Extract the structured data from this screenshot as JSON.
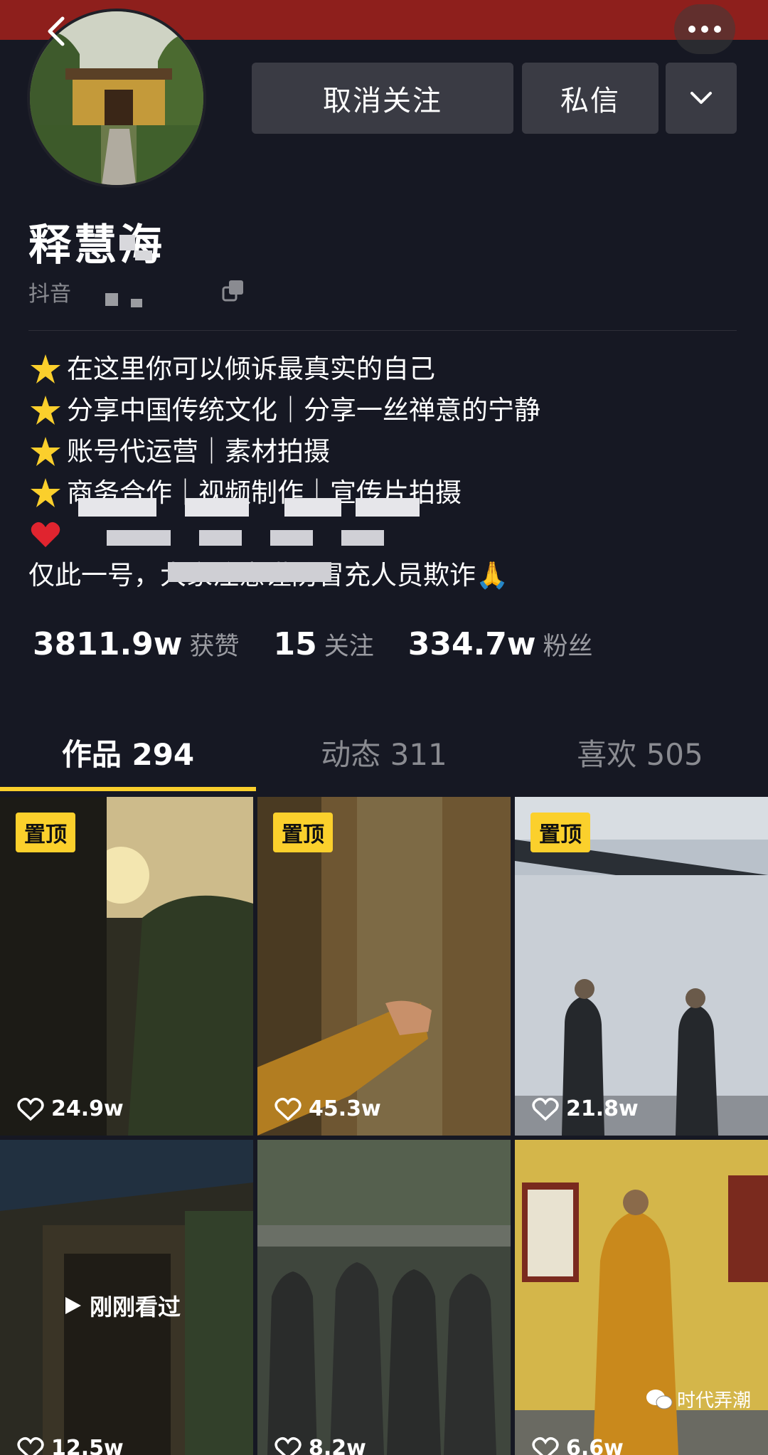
{
  "header": {
    "back_icon": "chevron-left-icon",
    "more_icon": "more-dots-icon"
  },
  "actions": {
    "unfollow_label": "取消关注",
    "message_label": "私信",
    "dropdown_icon": "chevron-down-icon"
  },
  "profile": {
    "name": "释慧海",
    "douyin_id_prefix": "抖音"
  },
  "bio": [
    {
      "emoji": "star",
      "text": "在这里你可以倾诉最真实的自己"
    },
    {
      "emoji": "star",
      "text": "分享中国传统文化｜分享一丝禅意的宁静"
    },
    {
      "emoji": "star",
      "text": "账号代运营｜素材拍摄"
    },
    {
      "emoji": "star",
      "text": "商务合作｜视频制作｜宣传片拍摄"
    },
    {
      "emoji": "heart",
      "text": ""
    },
    {
      "emoji": "",
      "text": "仅此一号，大家注意谨防冒充人员欺诈🙏"
    }
  ],
  "stats": {
    "likes_value": "3811.9w",
    "likes_label": "获赞",
    "following_value": "15",
    "following_label": "关注",
    "followers_value": "334.7w",
    "followers_label": "粉丝"
  },
  "tabs": [
    {
      "label": "作品 294",
      "active": true
    },
    {
      "label": "动态 311",
      "active": false
    },
    {
      "label": "喜欢 505",
      "active": false
    }
  ],
  "videos": [
    {
      "pinned": true,
      "pin_label": "置顶",
      "likes": "24.9w"
    },
    {
      "pinned": true,
      "pin_label": "置顶",
      "likes": "45.3w"
    },
    {
      "pinned": true,
      "pin_label": "置顶",
      "likes": "21.8w"
    },
    {
      "pinned": false,
      "likes": "12.5w",
      "watched_label": "刚刚看过"
    },
    {
      "pinned": false,
      "likes": "8.2w"
    },
    {
      "pinned": false,
      "likes": "6.6w"
    }
  ],
  "watermark": {
    "text": "时代弄潮",
    "icon": "wechat-icon"
  },
  "colors": {
    "background": "#161823",
    "accent": "#fbcf2c",
    "button": "#3a3b44",
    "top_band": "#8e1f1c"
  }
}
